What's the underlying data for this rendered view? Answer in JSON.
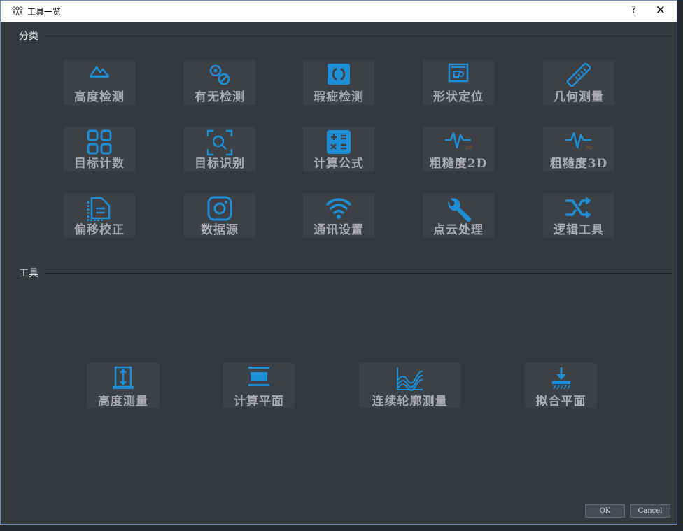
{
  "window": {
    "title": "工具一览",
    "help_label": "?",
    "close_label": "✕"
  },
  "sections": {
    "categories": "分类",
    "tools": "工具"
  },
  "categories": [
    {
      "label": "高度检测",
      "icon": "mountain-icon"
    },
    {
      "label": "有无检测",
      "icon": "presence-icon"
    },
    {
      "label": "瑕疵检测",
      "icon": "defect-icon"
    },
    {
      "label": "形状定位",
      "icon": "shape-locate-icon"
    },
    {
      "label": "几何测量",
      "icon": "ruler-icon"
    },
    {
      "label": "目标计数",
      "icon": "grid-icon"
    },
    {
      "label": "目标识别",
      "icon": "scan-search-icon"
    },
    {
      "label": "计算公式",
      "icon": "calculator-icon"
    },
    {
      "label": "粗糙度2D",
      "icon": "waveform-2d-icon",
      "badge": "2D"
    },
    {
      "label": "粗糙度3D",
      "icon": "waveform-3d-icon",
      "badge": "3D"
    },
    {
      "label": "偏移校正",
      "icon": "offset-correct-icon"
    },
    {
      "label": "数据源",
      "icon": "camera-icon"
    },
    {
      "label": "通讯设置",
      "icon": "wifi-icon"
    },
    {
      "label": "点云处理",
      "icon": "wrench-icon"
    },
    {
      "label": "逻辑工具",
      "icon": "shuffle-icon"
    }
  ],
  "tools": [
    {
      "label": "高度测量",
      "icon": "height-measure-icon"
    },
    {
      "label": "计算平面",
      "icon": "plane-icon"
    },
    {
      "label": "连续轮廓测量",
      "icon": "profile-wave-icon"
    },
    {
      "label": "拟合平面",
      "icon": "fit-plane-icon"
    }
  ],
  "footer": {
    "ok_label": "OK",
    "cancel_label": "Cancel"
  },
  "colors": {
    "accent": "#1e8fd6",
    "tile_bg": "#3d4145",
    "window_bg": "#34393e",
    "label": "#a9abad"
  }
}
